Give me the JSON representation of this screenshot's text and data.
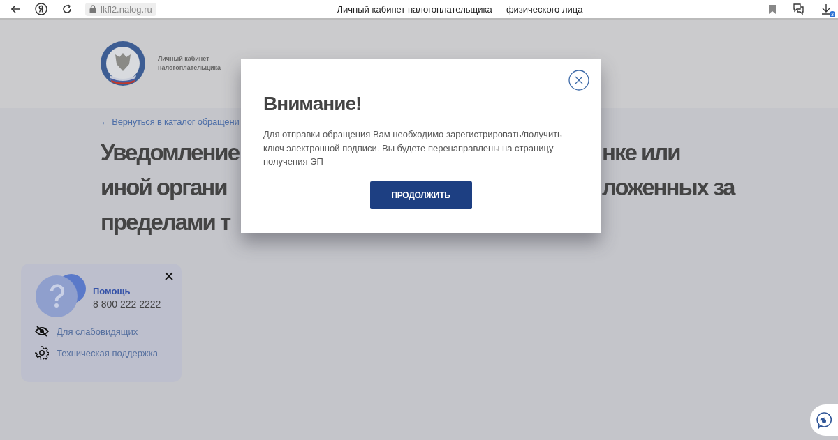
{
  "browser": {
    "url": "lkfl2.nalog.ru",
    "title": "Личный кабинет налогоплательщика — физического лица",
    "downloads_badge": "3"
  },
  "header": {
    "logo_caption": "Личный кабинет налогоплательщика"
  },
  "back_link": "← Вернуться в каталог обращени",
  "heading_fragments": [
    {
      "left": "Уведомление",
      "right": "нке или"
    },
    {
      "left": "иной органи",
      "right": "ложенных за"
    },
    {
      "left": "пределами т"
    }
  ],
  "help_panel": {
    "title": "Помощь",
    "phone": "8 800 222 2222",
    "links": [
      {
        "label": "Для слабовидящих",
        "kind": "accessibility"
      },
      {
        "label": "Техническая поддержка",
        "kind": "support"
      }
    ]
  },
  "modal": {
    "title": "Внимание!",
    "message": "Для отправки обращения Вам необходимо зарегистрировать/получить ключ электронной подписи. Вы будете перенаправлены на страницу получения ЭП",
    "button": "ПРОДОЛЖИТЬ"
  }
}
